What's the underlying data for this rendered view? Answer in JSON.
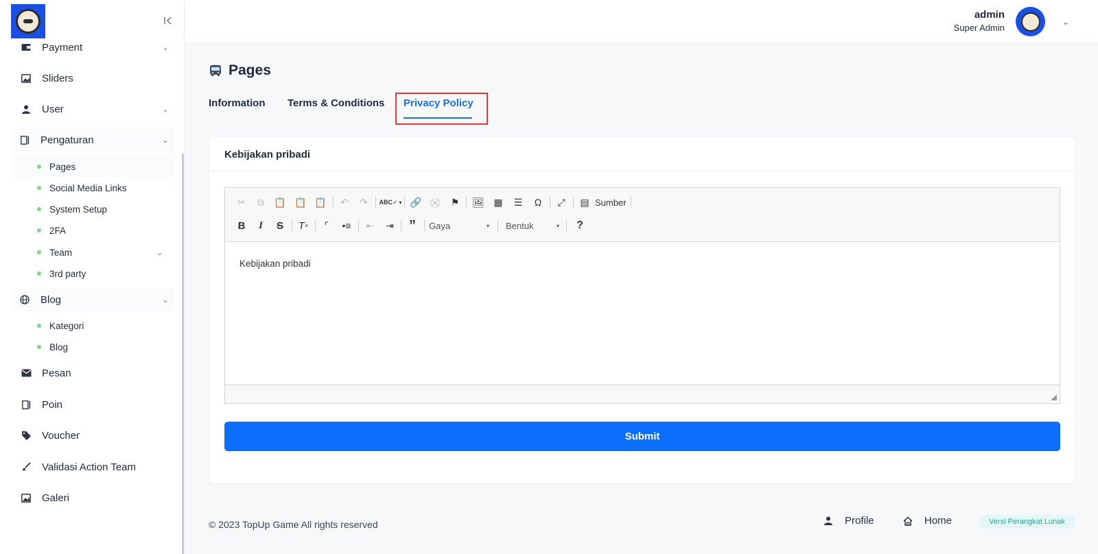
{
  "sidebar": {
    "items": [
      {
        "label": "Payment",
        "icon": "wallet-icon",
        "has_children": true
      },
      {
        "label": "Sliders",
        "icon": "image-icon",
        "has_children": false
      },
      {
        "label": "User",
        "icon": "user-icon",
        "has_children": true
      },
      {
        "label": "Pengaturan",
        "icon": "settings-panel-icon",
        "has_children": true
      },
      {
        "label": "Blog",
        "icon": "globe-icon",
        "has_children": true
      },
      {
        "label": "Pesan",
        "icon": "mail-icon",
        "has_children": false
      },
      {
        "label": "Poin",
        "icon": "panel-icon",
        "has_children": false
      },
      {
        "label": "Voucher",
        "icon": "tag-icon",
        "has_children": false
      },
      {
        "label": "Validasi Action Team",
        "icon": "brush-icon",
        "has_children": false
      },
      {
        "label": "Galeri",
        "icon": "image-icon",
        "has_children": false
      }
    ],
    "pengaturan_children": [
      {
        "label": "Pages"
      },
      {
        "label": "Social Media Links"
      },
      {
        "label": "System Setup"
      },
      {
        "label": "2FA"
      },
      {
        "label": "Team",
        "has_children": true
      },
      {
        "label": "3rd party"
      }
    ],
    "blog_children": [
      {
        "label": "Kategori"
      },
      {
        "label": "Blog"
      }
    ]
  },
  "header": {
    "user_name": "admin",
    "user_role": "Super Admin"
  },
  "page": {
    "title": "Pages",
    "tabs": [
      {
        "label": "Information",
        "active": false
      },
      {
        "label": "Terms & Conditions",
        "active": false
      },
      {
        "label": "Privacy Policy",
        "active": true
      }
    ],
    "card_title": "Kebijakan pribadi"
  },
  "editor": {
    "source_label": "Sumber",
    "style_combo": "Gaya",
    "format_combo": "Bentuk",
    "content": "Kebijakan pribadi"
  },
  "form": {
    "submit_label": "Submit"
  },
  "footer": {
    "copyright": "© 2023 TopUp Game All rights reserved",
    "profile_label": "Profile",
    "home_label": "Home",
    "version_label": "Versi Perangkat Lunak"
  },
  "colors": {
    "primary": "#0d6efd",
    "tab_active": "#1a6fd6",
    "highlight_border": "#e23a3a",
    "sub_dot": "#7fd68a",
    "badge_text": "#1fa89a"
  }
}
